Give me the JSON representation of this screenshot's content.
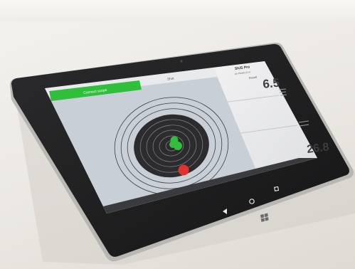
{
  "app": {
    "connect_button_label": "Connect scope",
    "tab_label": "Shot",
    "panel_title": "SIUS Pro",
    "panel_subtitle": "Air Pistol 10 m",
    "score_label": "Result",
    "score_value": "6.5",
    "stat_value": "26.8",
    "accent_color": "#2fbf3b",
    "impact_color": "#e0332f"
  },
  "system_bar": {
    "icons": [
      "back-icon",
      "home-icon",
      "recent-apps-icon"
    ]
  },
  "device": {
    "hardware_logo": "windows-logo-icon"
  }
}
